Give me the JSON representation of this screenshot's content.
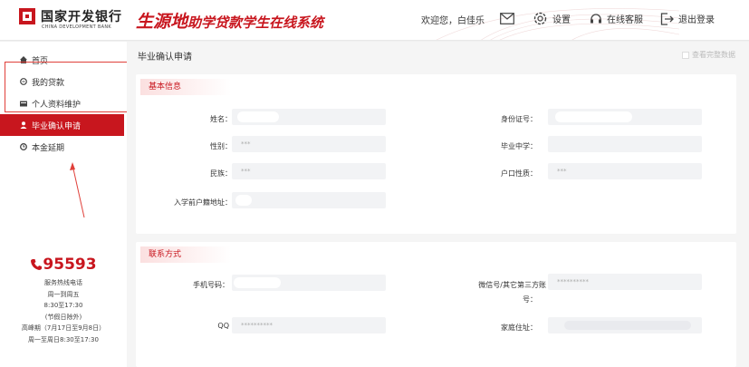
{
  "header": {
    "bank_name_cn": "国家开发银行",
    "bank_name_en": "CHINA DEVELOPMENT BANK",
    "system_title_main": "生源地",
    "system_title_sub": "助学贷款学生在线系统",
    "welcome": "欢迎您，白佳乐",
    "settings_label": "设置",
    "service_label": "在线客服",
    "logout_label": "退出登录",
    "brand_color": "#c8161e"
  },
  "sidebar": {
    "items": [
      {
        "label": "首页",
        "icon": "home-icon"
      },
      {
        "label": "我的贷款",
        "icon": "coin-icon"
      },
      {
        "label": "个人资料维护",
        "icon": "card-icon"
      },
      {
        "label": "毕业确认申请",
        "icon": "user-icon",
        "active": true
      },
      {
        "label": "本金延期",
        "icon": "clock-icon"
      }
    ],
    "hotline": {
      "number": "95593",
      "lines": [
        "服务热线电话",
        "周一到周五",
        "8:30至17:30",
        "(节假日除外)",
        "高峰期（7月17日至9月8日）",
        "周一至周日8:30至17:30"
      ]
    }
  },
  "main": {
    "page_title": "毕业确认申请",
    "view_full_label": "查看完整数据",
    "basic_info": {
      "title": "基本信息",
      "fields": {
        "name_label": "姓名：",
        "id_label": "身份证号：",
        "gender_label": "性别：",
        "gender_value": "***",
        "school_label": "毕业中学：",
        "ethnicity_label": "民族：",
        "ethnicity_value": "***",
        "hukou_label": "户口性质：",
        "hukou_value": "***",
        "address_label": "入学前户籍地址："
      }
    },
    "contact": {
      "title": "联系方式",
      "fields": {
        "phone_label": "手机号码：",
        "wechat_label_1": "微信号/其它第三方账",
        "wechat_label_2": "号：",
        "wechat_value": "**********",
        "qq_label": "QQ",
        "qq_value": "**********",
        "home_label": "家庭住址："
      }
    }
  }
}
